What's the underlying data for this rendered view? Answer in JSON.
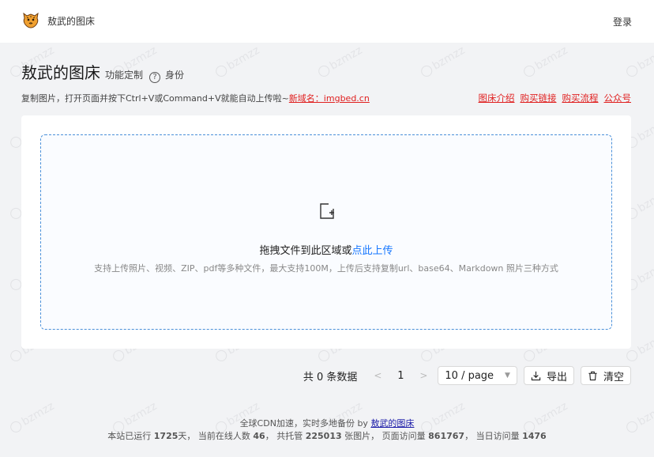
{
  "header": {
    "brand": "敖武的图床",
    "login": "登录"
  },
  "title": {
    "main": "敖武的图床",
    "custom": "功能定制",
    "identity": "身份"
  },
  "description": {
    "text": "复制图片，打开页面并按下Ctrl+V或Command+V就能自动上传啦~",
    "domain": "新域名：imgbed.cn"
  },
  "links": [
    "图床介绍",
    "购买链接",
    "购买流程",
    "公众号"
  ],
  "upload": {
    "prompt": "拖拽文件到此区域或",
    "link": "点此上传",
    "hint": "支持上传照片、视频、ZIP、pdf等多种文件，最大支持100M，上传后支持复制url、base64、Markdown 照片三种方式"
  },
  "pager": {
    "total": "共 0 条数据",
    "prev": "<",
    "page": "1",
    "next": ">",
    "page_size": "10 / page",
    "export": "导出",
    "clear": "清空"
  },
  "footer": {
    "line1_prefix": "全球CDN加速，实时多地备份 by",
    "line1_link": "敖武的图床",
    "uptime_label": "本站已运行",
    "uptime_value": "1725",
    "uptime_unit": "天，",
    "online_label": "当前在线人数",
    "online_value": "46",
    "hosted_label": "，   共托管",
    "hosted_value": "225013",
    "hosted_unit": "张图片，",
    "pv_label": "页面访问量",
    "pv_value": "861767",
    "today_label": "，   当日访问量",
    "today_value": "1476"
  },
  "watermark": "bzmzz",
  "colors": {
    "accent": "#1677ff",
    "link_red": "#e02020",
    "dropzone_border": "#4a90d9",
    "background": "#f2f3f5"
  }
}
